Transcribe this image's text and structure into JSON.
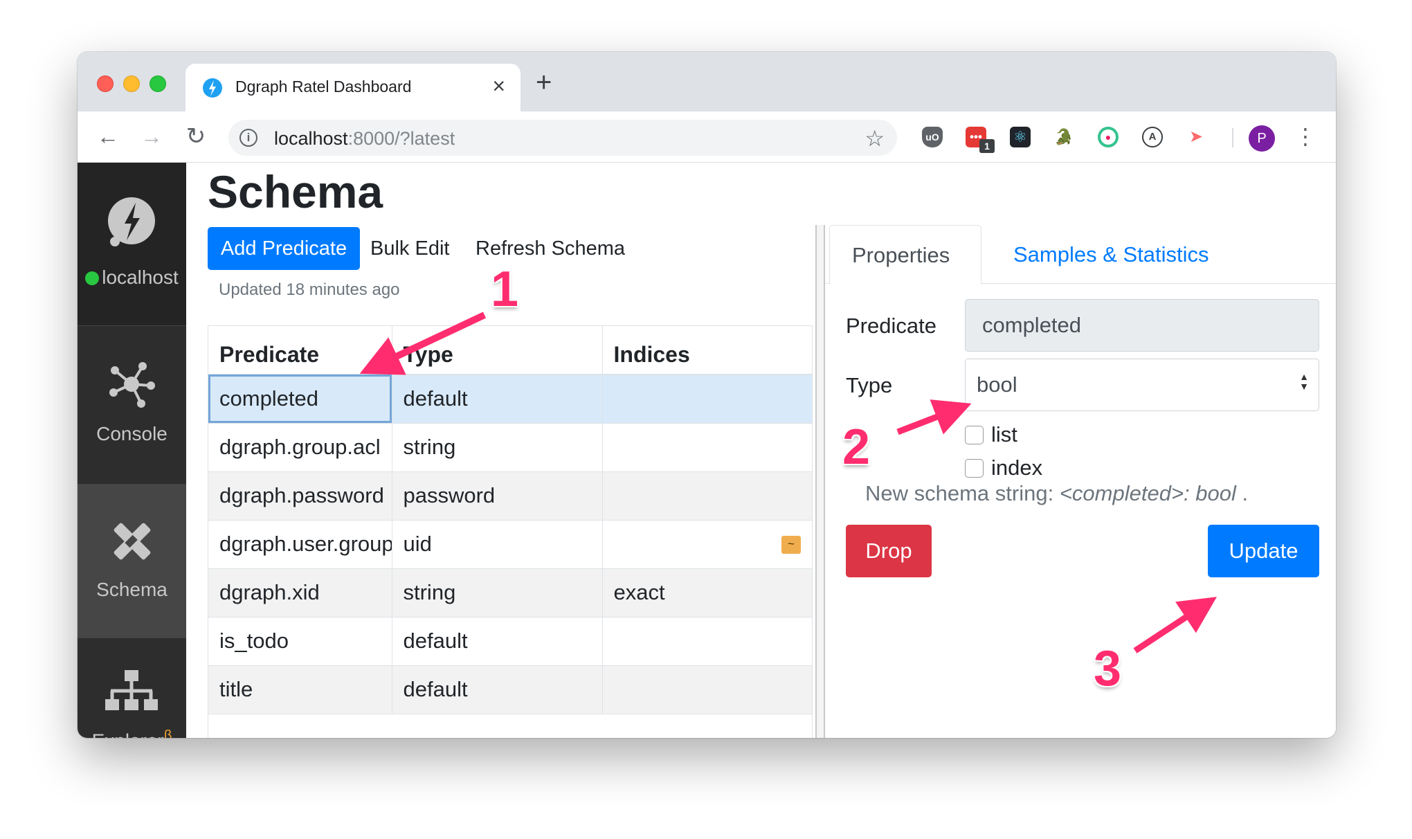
{
  "browser": {
    "tab_title": "Dgraph Ratel Dashboard",
    "url_host": "localhost",
    "url_rest": ":8000/?latest",
    "extension_badge": "1",
    "profile_initial": "P"
  },
  "sidebar": {
    "server_label": "localhost",
    "items": [
      {
        "label": "Console"
      },
      {
        "label": "Schema"
      },
      {
        "label": "Explorer"
      }
    ],
    "explorer_badge": "β"
  },
  "page": {
    "title": "Schema",
    "add_label": "Add Predicate",
    "bulk_label": "Bulk Edit",
    "refresh_label": "Refresh Schema",
    "updated": "Updated 18 minutes ago"
  },
  "table": {
    "headers": [
      "Predicate",
      "Type",
      "Indices"
    ],
    "rows": [
      {
        "predicate": "completed",
        "type": "default",
        "indices": ""
      },
      {
        "predicate": "dgraph.group.acl",
        "type": "string",
        "indices": ""
      },
      {
        "predicate": "dgraph.password",
        "type": "password",
        "indices": ""
      },
      {
        "predicate": "dgraph.user.group",
        "type": "uid",
        "indices": "",
        "warn": "~"
      },
      {
        "predicate": "dgraph.xid",
        "type": "string",
        "indices": "exact"
      },
      {
        "predicate": "is_todo",
        "type": "default",
        "indices": ""
      },
      {
        "predicate": "title",
        "type": "default",
        "indices": ""
      }
    ]
  },
  "panel": {
    "tabs": [
      "Properties",
      "Samples & Statistics"
    ],
    "predicate_label": "Predicate",
    "predicate_value": "completed",
    "type_label": "Type",
    "type_value": "bool",
    "list_label": "list",
    "index_label": "index",
    "schema_prefix": "New schema string: ",
    "schema_code": "<completed>: bool",
    "schema_suffix": " .",
    "drop_label": "Drop",
    "update_label": "Update"
  },
  "annotations": {
    "color": "#ff2d6f",
    "steps": [
      "1",
      "2",
      "3"
    ]
  }
}
